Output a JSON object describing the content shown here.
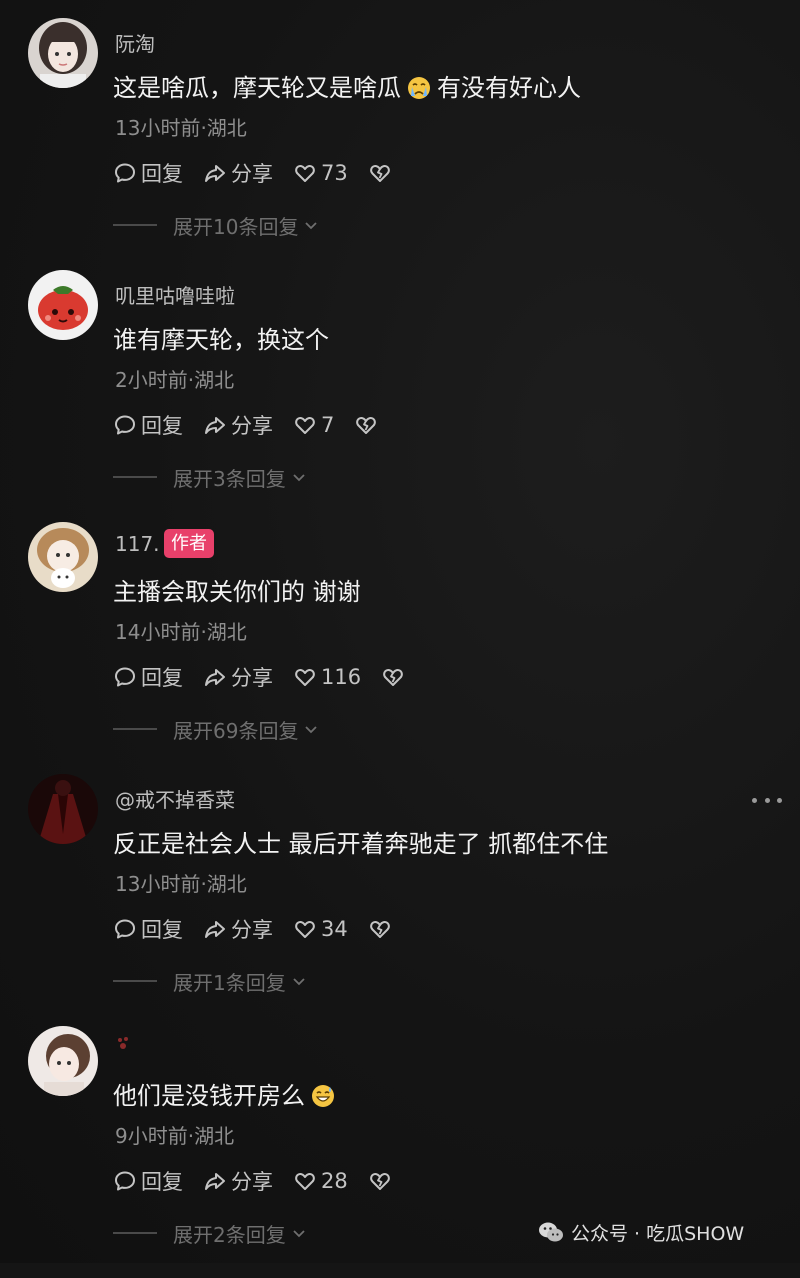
{
  "comments": [
    {
      "username": "阮淘",
      "badge": "",
      "text_pre": "这是啥瓜，摩天轮又是啥瓜",
      "emoji": "crying-face",
      "text_post": "有没有好心人",
      "meta": "13小时前·湖北",
      "reply_label": "回复",
      "share_label": "分享",
      "likes": "73",
      "expand": "展开10条回复"
    },
    {
      "username": "叽里咕噜哇啦",
      "badge": "",
      "text_pre": "谁有摩天轮，换这个",
      "emoji": "",
      "text_post": "",
      "meta": "2小时前·湖北",
      "reply_label": "回复",
      "share_label": "分享",
      "likes": "7",
      "expand": "展开3条回复"
    },
    {
      "username": "117.",
      "badge": "作者",
      "text_pre": "主播会取关你们的 谢谢",
      "emoji": "",
      "text_post": "",
      "meta": "14小时前·湖北",
      "reply_label": "回复",
      "share_label": "分享",
      "likes": "116",
      "expand": "展开69条回复"
    },
    {
      "username": "@戒不掉香菜",
      "badge": "",
      "text_pre": "反正是社会人士 最后开着奔驰走了 抓都住不住",
      "emoji": "",
      "text_post": "",
      "meta": "13小时前·湖北",
      "reply_label": "回复",
      "share_label": "分享",
      "likes": "34",
      "expand": "展开1条回复"
    },
    {
      "username": "",
      "badge": "",
      "text_pre": "他们是没钱开房么",
      "emoji": "grinning-sweat-face",
      "text_post": "",
      "meta": "9小时前·湖北",
      "reply_label": "回复",
      "share_label": "分享",
      "likes": "28",
      "expand": "展开2条回复"
    }
  ],
  "watermark": "公众号 · 吃瓜SHOW",
  "icons": {
    "reply": "speech-bubble-icon",
    "share": "share-arrow-icon",
    "like": "heart-outline-icon",
    "dislike": "broken-heart-icon",
    "expand": "chevron-down-icon",
    "more": "more-dots-icon",
    "watermark": "wechat-logo-icon"
  },
  "colors": {
    "background": "#151515",
    "author_badge": "#e8406a"
  }
}
